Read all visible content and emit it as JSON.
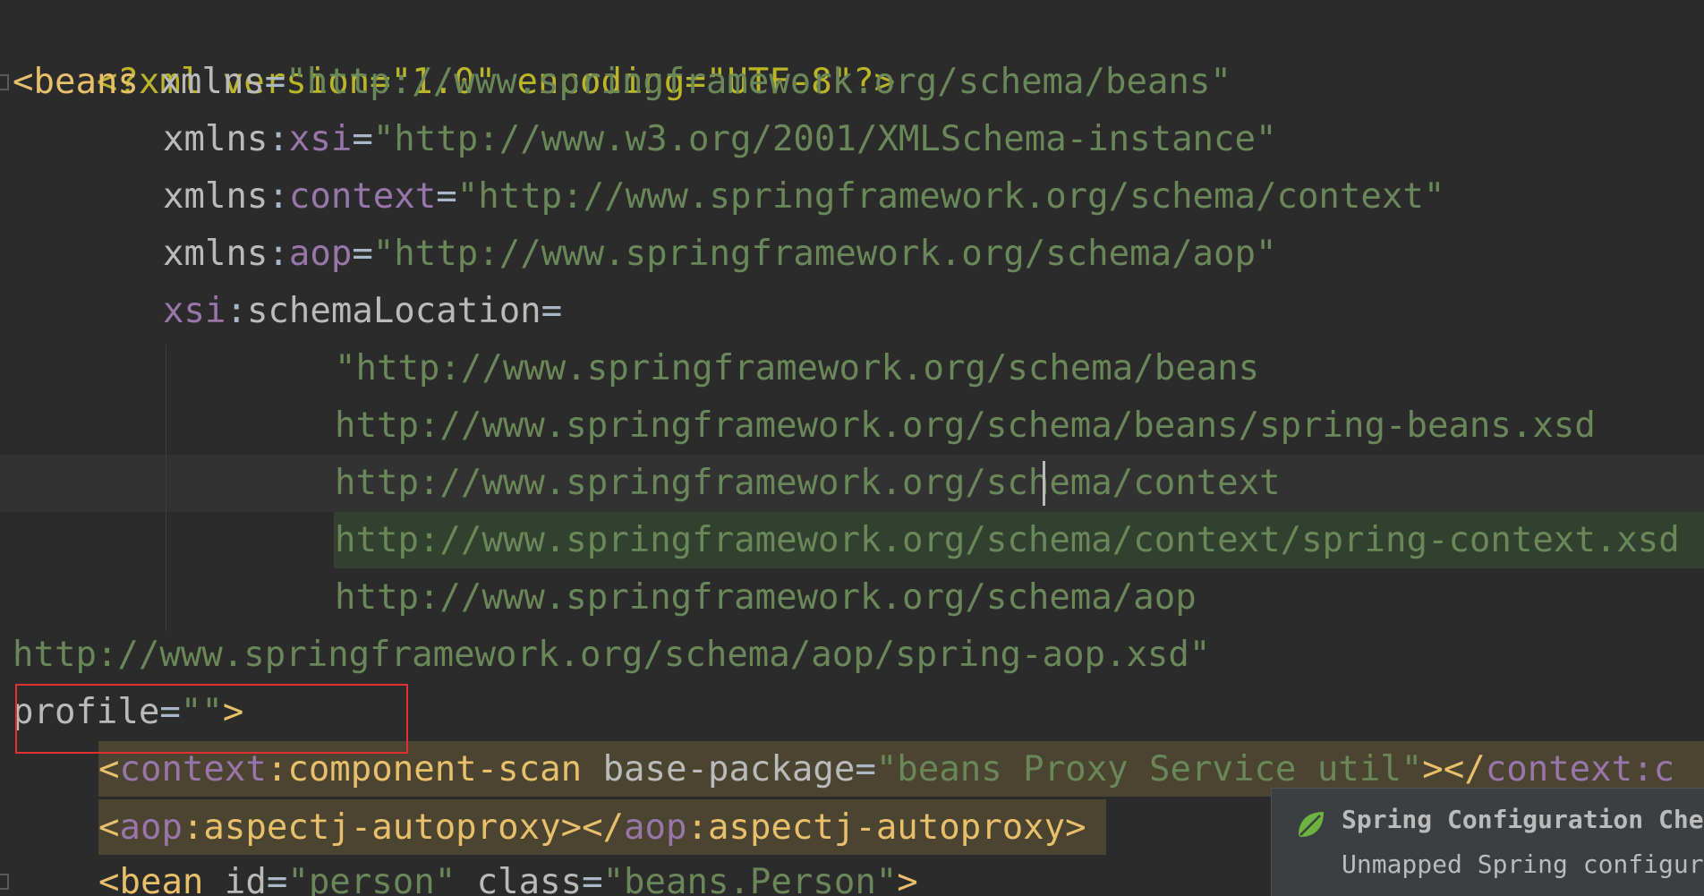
{
  "editor": {
    "line_xml_decl": "<?xml version=\"1.0\" encoding=\"UTF-8\"?>",
    "beans_open": "<beans",
    "xmlns_attr": "xmlns",
    "xmlns_value": "\"http://www.springframework.org/schema/beans\"",
    "xmlns_prefix": "xmlns",
    "ns_xsi": "xsi",
    "xsi_value": "\"http://www.w3.org/2001/XMLSchema-instance\"",
    "ns_context": "context",
    "context_value": "\"http://www.springframework.org/schema/context\"",
    "ns_aop": "aop",
    "aop_value": "\"http://www.springframework.org/schema/aop\"",
    "schema_location_attr": "schemaLocation",
    "schema_lines": [
      "\"http://www.springframework.org/schema/beans",
      "http://www.springframework.org/schema/beans/spring-beans.xsd",
      "http://www.springframework.org/schema/context",
      "http://www.springframework.org/schema/context/spring-context.xsd",
      "http://www.springframework.org/schema/aop",
      "http://www.springframework.org/schema/aop/spring-aop.xsd\""
    ],
    "profile_attr": "profile",
    "profile_value": "\"\"",
    "component_scan_ns": "context",
    "component_scan_tag": "component-scan",
    "base_package_attr": "base-package",
    "base_package_value": "\"beans Proxy Service util\"",
    "component_scan_close": "></",
    "component_scan_close_tail": "context:c",
    "aop_ns": "aop",
    "aspectj_tag": "aspectj-autoproxy",
    "bean_tag": "<bean",
    "bean_id_attr": "id",
    "bean_id_value": "\"person\"",
    "bean_class_attr": "class",
    "bean_class_value": "\"beans.Person\""
  },
  "notification": {
    "title": "Spring Configuration Check",
    "text": "Unmapped Spring configuration",
    "icon": "spring-leaf-icon"
  },
  "colors": {
    "background": "#2b2b2b",
    "tag": "#e8bf6a",
    "string": "#6a8759",
    "namespace": "#9876aa",
    "attribute": "#bababa",
    "highlight_box": "#e03030"
  }
}
